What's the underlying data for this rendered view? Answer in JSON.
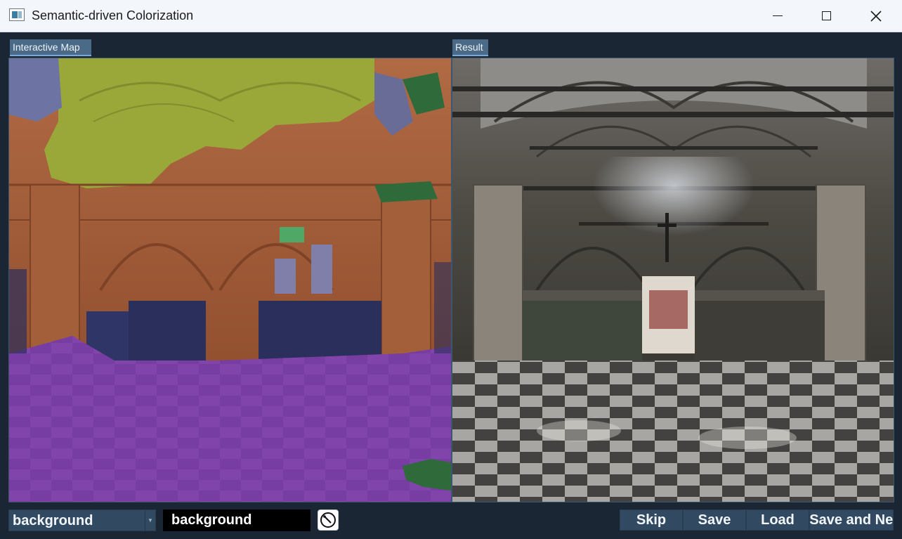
{
  "window": {
    "title": "Semantic-driven Colorization"
  },
  "tabs": {
    "map_label": "Interactive Map",
    "result_label": "Result"
  },
  "toolbar": {
    "class_select_value": "background",
    "class_label_value": "background",
    "skip_label": "Skip",
    "save_label": "Save",
    "load_label": "Load",
    "save_next_label": "Save and Next"
  },
  "colors": {
    "background": "#1a2633",
    "button": "#324a61",
    "tab": "#4a6a88",
    "mask_ceiling": "#9aa83a",
    "mask_wall": "#a8603a",
    "mask_floor": "#7e3fa6",
    "mask_furniture": "#2b2f5c",
    "mask_plant": "#2f6b3a"
  }
}
